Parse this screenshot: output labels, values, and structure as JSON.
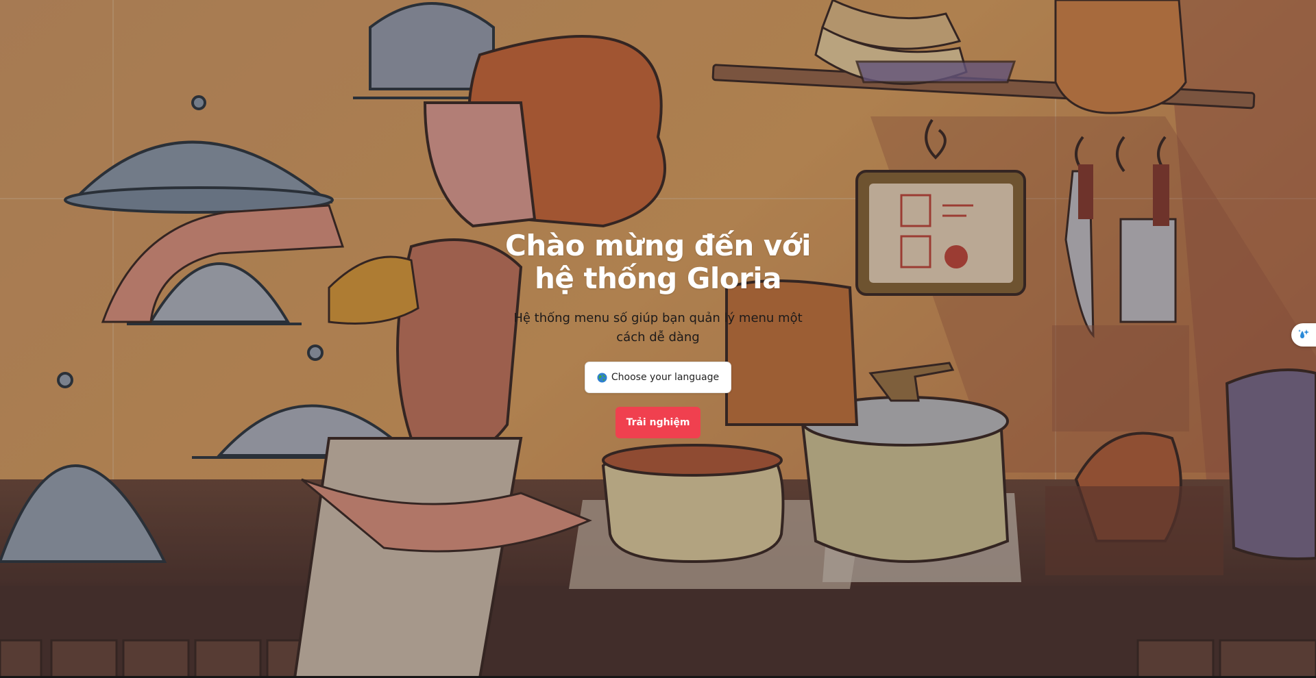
{
  "hero": {
    "title_line1": "Chào mừng đến với",
    "title_line2": "hệ thống Gloria",
    "subtitle": "Hệ thống menu số giúp bạn quản lý menu một cách dễ dàng"
  },
  "language_button": {
    "label": "Choose your language",
    "icon": "globe-icon"
  },
  "cta_button": {
    "label": "Trải nghiệm"
  },
  "side_widget": {
    "icon": "sparkle-droplet-icon"
  },
  "colors": {
    "cta": "#f0404f",
    "title": "#ffffff",
    "subtitle": "#1d1a1a",
    "background_art": "#d99a5c"
  }
}
